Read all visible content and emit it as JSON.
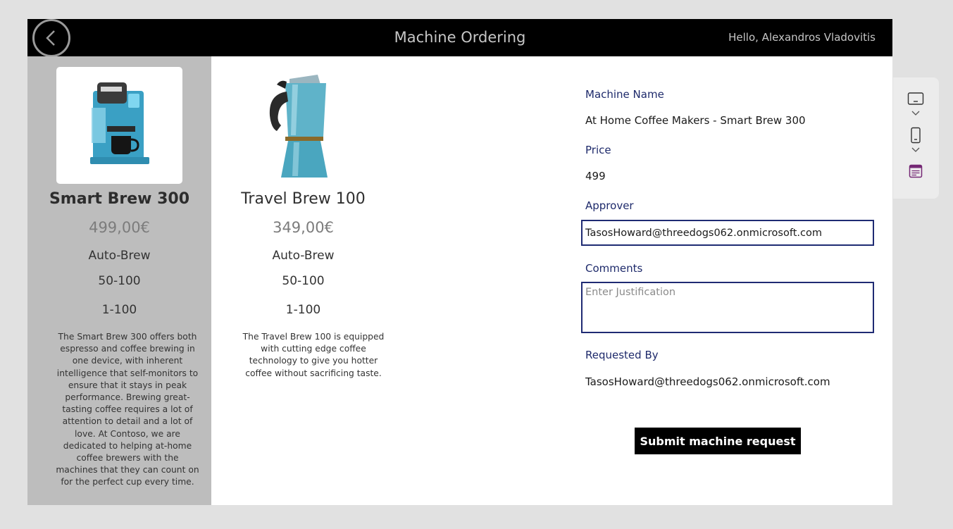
{
  "header": {
    "title": "Machine Ordering",
    "greeting": "Hello, Alexandros Vladovitis",
    "back_icon": "chevron-left-circle-icon"
  },
  "gallery": {
    "items": [
      {
        "name": "Smart Brew 300",
        "price": "499,00€",
        "mode": "Auto-Brew",
        "range1": "50-100",
        "range2": "1-100",
        "description": "The Smart Brew 300 offers both espresso and coffee brewing in one device, with inherent intelligence that self-monitors to ensure that it stays in peak performance. Brewing great-tasting coffee requires a lot of attention to detail and a lot of love. At Contoso, we are dedicated to helping at-home coffee brewers with the machines that they can count on for the perfect cup every time.",
        "image_icon": "coffee-machine-icon",
        "selected": true
      },
      {
        "name": "Travel Brew 100",
        "price": "349,00€",
        "mode": "Auto-Brew",
        "range1": "50-100",
        "range2": "1-100",
        "description": "The Travel Brew 100 is equipped with cutting edge coffee technology to give you hotter coffee without sacrificing taste.",
        "image_icon": "moka-pot-icon",
        "selected": false
      }
    ]
  },
  "form": {
    "machine_name_label": "Machine Name",
    "machine_name_value": "At Home Coffee Makers - Smart Brew 300",
    "price_label": "Price",
    "price_value": "499",
    "approver_label": "Approver",
    "approver_value": "TasosHoward@threedogs062.onmicrosoft.com",
    "comments_label": "Comments",
    "comments_placeholder": "Enter Justification",
    "requested_by_label": "Requested By",
    "requested_by_value": "TasosHoward@threedogs062.onmicrosoft.com",
    "submit_label": "Submit machine request"
  },
  "toolbar": {
    "items": [
      "tablet-layout-icon",
      "chevron-down-icon",
      "phone-layout-icon",
      "chevron-down-icon",
      "form-layout-icon"
    ]
  },
  "colors": {
    "header_bg": "#000000",
    "selected_bg": "#bdbdbd",
    "label_color": "#1e2a6b",
    "input_border": "#1f2b73",
    "accent_purple": "#742774"
  }
}
